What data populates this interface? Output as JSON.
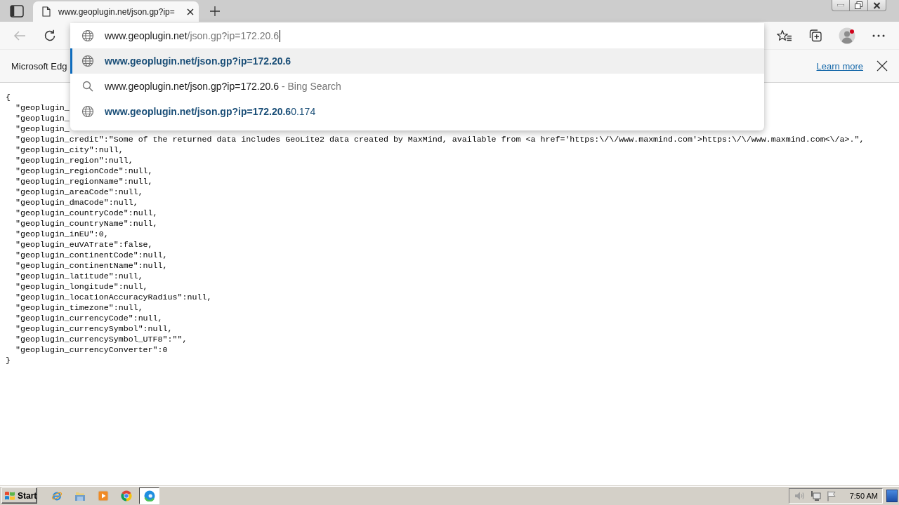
{
  "tab_strip": {
    "tabs": [
      {
        "title": "www.geoplugin.net/json.gp?ip=",
        "selected": true
      }
    ]
  },
  "toolbar": {
    "back": {
      "disabled": true
    },
    "profile": {
      "alert": true
    }
  },
  "address_bar": {
    "host": "www.geoplugin.net",
    "path": "/json.gp?ip=172.20.6",
    "suggestions": [
      {
        "kind": "url",
        "selected": true,
        "match": "www.geoplugin.net/json.gp?ip=172.20.6"
      },
      {
        "kind": "search",
        "selected": false,
        "text": "www.geoplugin.net/json.gp?ip=172.20.6",
        "suffix": "- Bing Search"
      },
      {
        "kind": "url",
        "selected": false,
        "match": "www.geoplugin.net/json.gp?ip=172.20.6",
        "completion": "0.174"
      }
    ]
  },
  "infobar": {
    "message": "Microsoft Edg",
    "link": "Learn more"
  },
  "page": {
    "open": "{",
    "entries": [
      "\"geoplugin_",
      "\"geoplugin_",
      "\"geoplugin_",
      "\"geoplugin_credit\":\"Some of the returned data includes GeoLite2 data created by MaxMind, available from <a href='https:\\/\\/www.maxmind.com'>https:\\/\\/www.maxmind.com<\\/a>.\",",
      "\"geoplugin_city\":null,",
      "\"geoplugin_region\":null,",
      "\"geoplugin_regionCode\":null,",
      "\"geoplugin_regionName\":null,",
      "\"geoplugin_areaCode\":null,",
      "\"geoplugin_dmaCode\":null,",
      "\"geoplugin_countryCode\":null,",
      "\"geoplugin_countryName\":null,",
      "\"geoplugin_inEU\":0,",
      "\"geoplugin_euVATrate\":false,",
      "\"geoplugin_continentCode\":null,",
      "\"geoplugin_continentName\":null,",
      "\"geoplugin_latitude\":null,",
      "\"geoplugin_longitude\":null,",
      "\"geoplugin_locationAccuracyRadius\":null,",
      "\"geoplugin_timezone\":null,",
      "\"geoplugin_currencyCode\":null,",
      "\"geoplugin_currencySymbol\":null,",
      "\"geoplugin_currencySymbol_UTF8\":\"\",",
      "\"geoplugin_currencyConverter\":0"
    ],
    "close": "}"
  },
  "taskbar": {
    "start": "Start",
    "apps": [
      {
        "kind": "ie",
        "selected": false
      },
      {
        "kind": "folder",
        "selected": false
      },
      {
        "kind": "player",
        "selected": false
      },
      {
        "kind": "chrome",
        "selected": false
      },
      {
        "kind": "edge",
        "selected": true
      }
    ],
    "clock": "7:50 AM"
  }
}
